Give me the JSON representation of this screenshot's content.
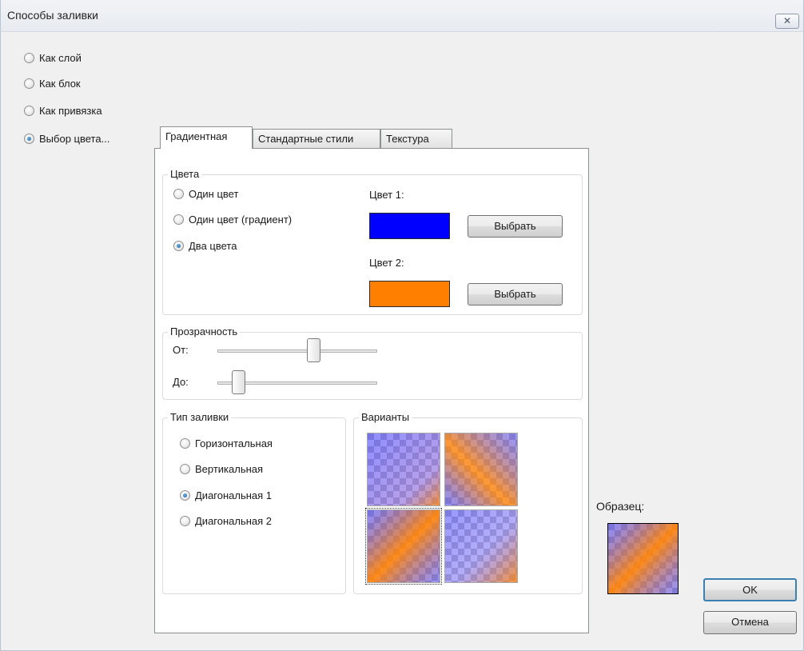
{
  "window": {
    "title": "Способы заливки",
    "close_glyph": "✕"
  },
  "left_options": [
    {
      "label": "Как слой",
      "checked": false
    },
    {
      "label": "Как блок",
      "checked": false
    },
    {
      "label": "Как привязка",
      "checked": false
    },
    {
      "label": "Выбор цвета...",
      "checked": true
    }
  ],
  "tabs": [
    {
      "label": "Градиентная",
      "active": true
    },
    {
      "label": "Стандартные стили",
      "active": false
    },
    {
      "label": "Текстура",
      "active": false
    }
  ],
  "colors_group": {
    "legend": "Цвета",
    "options": [
      {
        "label": "Один цвет",
        "checked": false
      },
      {
        "label": "Один цвет (градиент)",
        "checked": false
      },
      {
        "label": "Два цвета",
        "checked": true
      }
    ],
    "color1_label": "Цвет 1:",
    "color1": "#0000ff",
    "color2_label": "Цвет 2:",
    "color2": "#ff7f00",
    "choose_label": "Выбрать"
  },
  "transparency_group": {
    "legend": "Прозрачность",
    "from_label": "От:",
    "to_label": "До:",
    "from_value": 0.6,
    "to_value": 0.13
  },
  "fill_type_group": {
    "legend": "Тип заливки",
    "options": [
      {
        "label": "Горизонтальная",
        "checked": false
      },
      {
        "label": "Вертикальная",
        "checked": false
      },
      {
        "label": "Диагональная 1",
        "checked": true
      },
      {
        "label": "Диагональная 2",
        "checked": false
      }
    ]
  },
  "variants_group": {
    "legend": "Варианты",
    "selected_index": 2
  },
  "sample_label": "Образец:",
  "buttons": {
    "ok": "OK",
    "cancel": "Отмена"
  }
}
